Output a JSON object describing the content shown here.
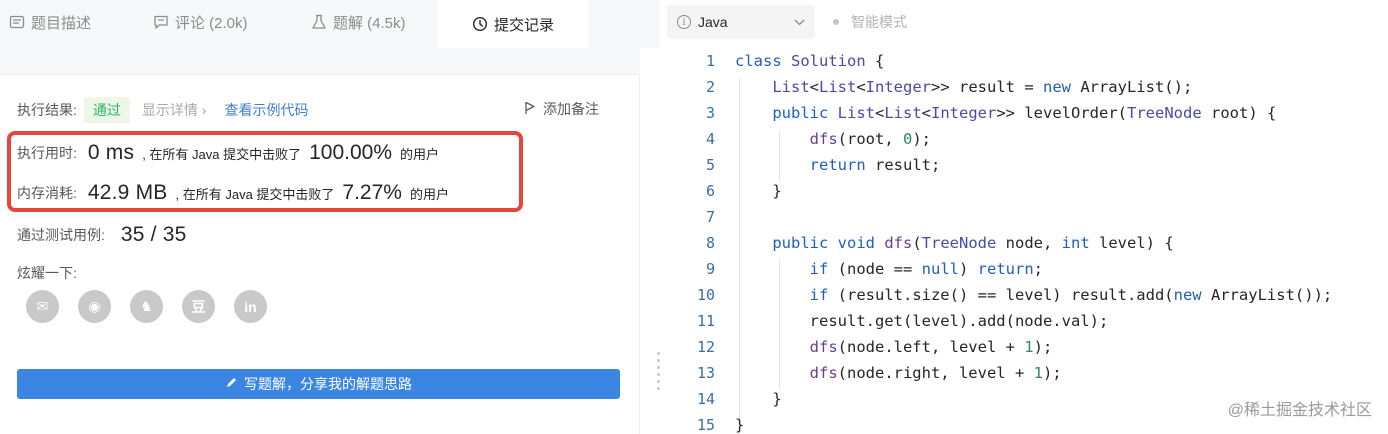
{
  "tabs": [
    {
      "label": "题目描述",
      "icon": "document-icon"
    },
    {
      "label": "评论 (2.0k)",
      "icon": "comment-icon"
    },
    {
      "label": "题解 (4.5k)",
      "icon": "flask-icon"
    },
    {
      "label": "提交记录",
      "icon": "clock-icon"
    }
  ],
  "result": {
    "label": "执行结果:",
    "status": "通过",
    "detail_link": "显示详情 ›",
    "example_link": "查看示例代码",
    "note_button": "添加备注"
  },
  "runtime": {
    "label": "执行用时:",
    "value": "0 ms",
    "middle": ", 在所有 Java 提交中击败了",
    "percent": "100.00%",
    "suffix": "的用户"
  },
  "memory": {
    "label": "内存消耗:",
    "value": "42.9 MB",
    "middle": ", 在所有 Java 提交中击败了",
    "percent": "7.27%",
    "suffix": "的用户"
  },
  "tests": {
    "label": "通过测试用例:",
    "value": "35 / 35"
  },
  "share": {
    "label": "炫耀一下:",
    "icons": [
      "wechat-icon",
      "weibo-icon",
      "qq-icon",
      "douban-icon",
      "linkedin-icon"
    ],
    "icon_glyphs": [
      "✉",
      "◉",
      "♞",
      "豆",
      "in"
    ]
  },
  "write_button": "写题解，分享我的解题思路",
  "editor": {
    "language": "Java",
    "mode": "智能模式",
    "line_numbers": [
      "1",
      "2",
      "3",
      "4",
      "5",
      "6",
      "7",
      "8",
      "9",
      "10",
      "11",
      "12",
      "13",
      "14",
      "15"
    ]
  },
  "watermark": "@稀土掘金技术社区",
  "colors": {
    "accent": "#3b86e3",
    "pass": "#2db55d",
    "highlight": "#e8453b"
  }
}
